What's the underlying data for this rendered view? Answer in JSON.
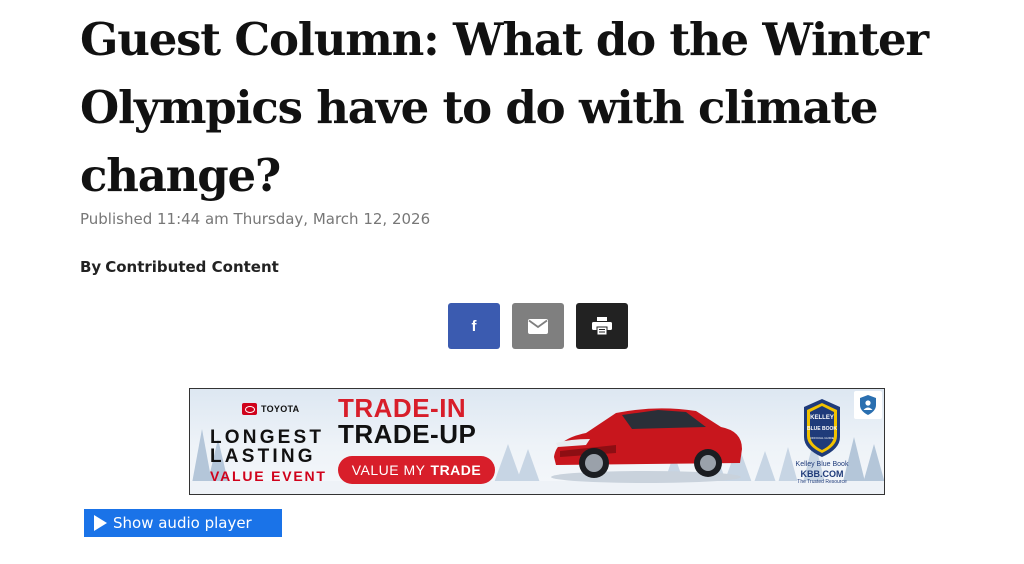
{
  "article": {
    "headline": "Guest Column: What do the Winter Olympics have to do with climate change?",
    "published": "Published 11:44 am Thursday, March 12, 2026",
    "byline_prefix": "By",
    "byline_author": "Contributed Content"
  },
  "share": {
    "facebook_icon": "f",
    "icons": [
      "facebook-icon",
      "email-icon",
      "print-icon"
    ],
    "colors": {
      "facebook": "#3b5bb0",
      "email": "#7f7f7f",
      "print": "#222222"
    }
  },
  "ad": {
    "brand": "TOYOTA",
    "line1": "LONGEST",
    "line2": "LASTING",
    "line3": "VALUE EVENT",
    "headline1": "TRADE-IN",
    "headline2": "TRADE-UP",
    "cta_prefix": "VALUE MY",
    "cta_bold": "TRADE",
    "kbb_seal_top": "KELLEY",
    "kbb_seal_mid": "BLUE BOOK",
    "kbb_seal_bottom": "OFFICIAL GUIDE",
    "kbb_name": "Kelley Blue Book",
    "kbb_url": "KBB.COM",
    "kbb_tagline": "The Trusted Resource",
    "accent_color": "#d81e2a"
  },
  "audio": {
    "label": "Show audio player",
    "color": "#1a73e8"
  }
}
